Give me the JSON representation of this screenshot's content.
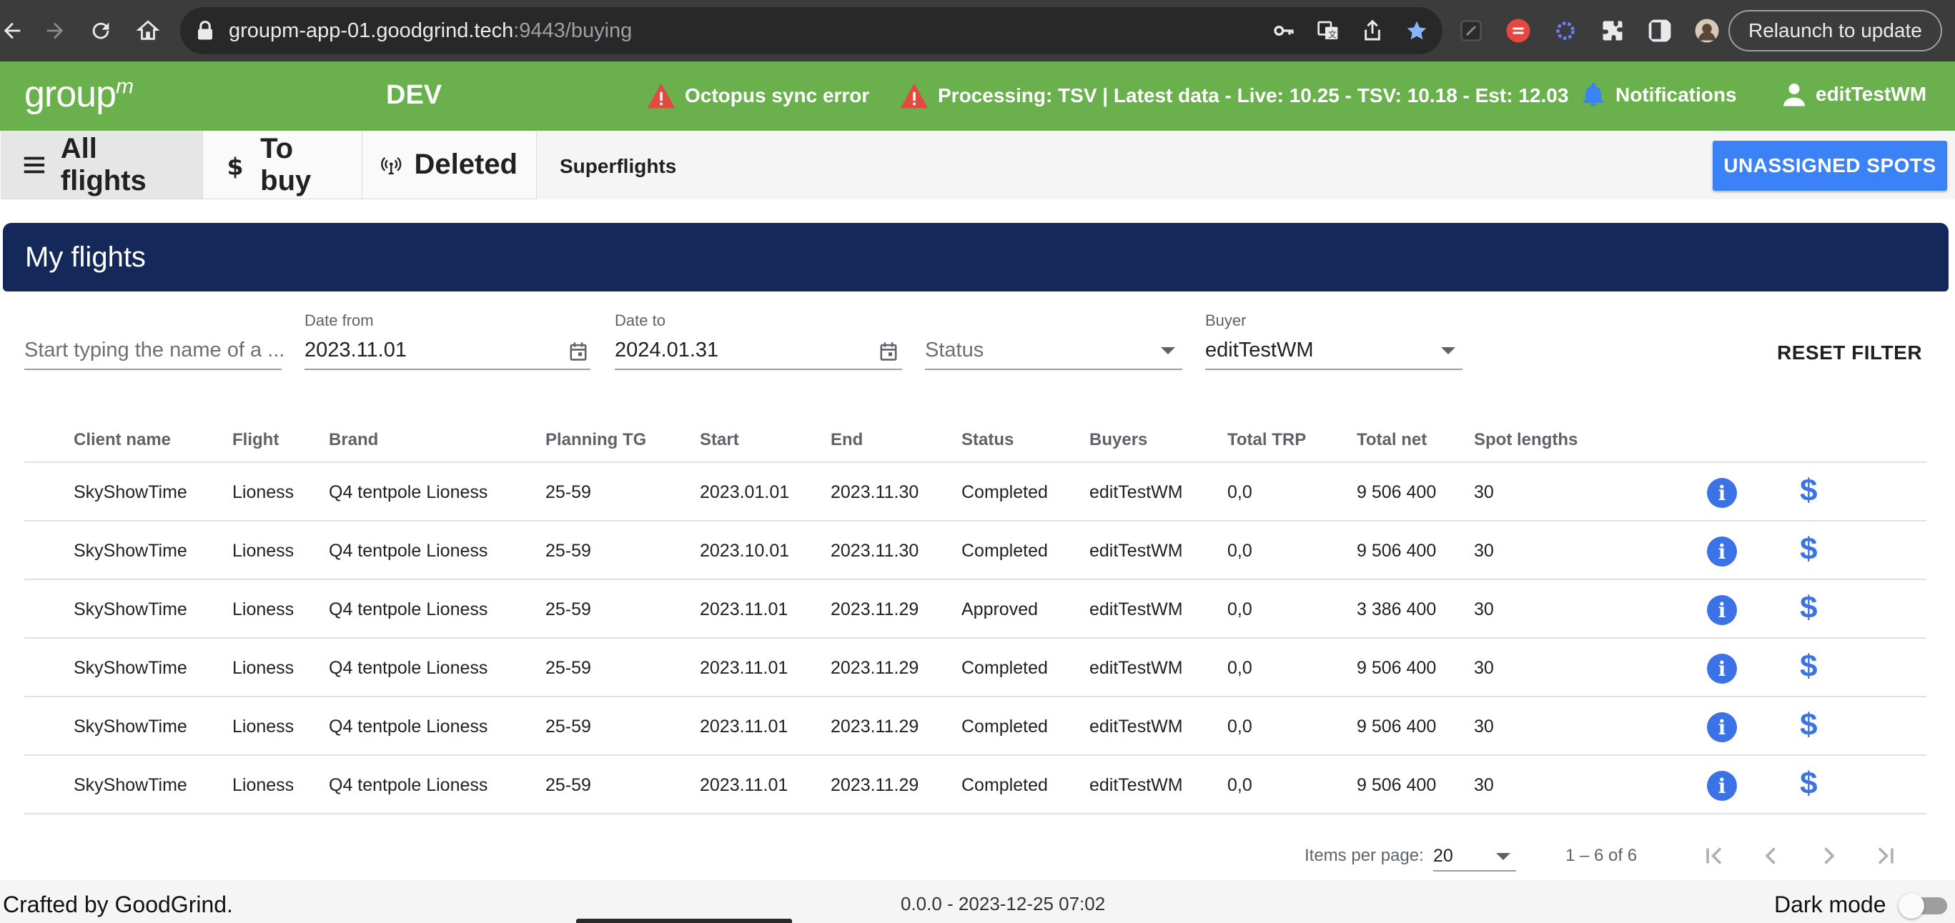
{
  "browser": {
    "url_host": "groupm-app-01.goodgrind.tech",
    "url_rest": ":9443/buying",
    "relaunch_label": "Relaunch to update"
  },
  "header": {
    "logo": "group",
    "logo_sup": "m",
    "env": "DEV",
    "sync_error": "Octopus sync error",
    "processing": "Processing: TSV | Latest data - Live: 10.25 - TSV: 10.18 - Est: 12.03",
    "notifications": "Notifications",
    "user": "editTestWM"
  },
  "tabs": {
    "all_flights": "All flights",
    "to_buy": "To buy",
    "deleted": "Deleted",
    "superflights": "Superflights",
    "unassigned": "UNASSIGNED SPOTS"
  },
  "panel": {
    "title": "My flights"
  },
  "filters": {
    "search_placeholder": "Start typing the name of a ...",
    "date_from_label": "Date from",
    "date_from": "2023.11.01",
    "date_to_label": "Date to",
    "date_to": "2024.01.31",
    "status_placeholder": "Status",
    "buyer_label": "Buyer",
    "buyer": "editTestWM",
    "reset": "RESET FILTER"
  },
  "table": {
    "columns": [
      "Client name",
      "Flight",
      "Brand",
      "Planning TG",
      "Start",
      "End",
      "Status",
      "Buyers",
      "Total TRP",
      "Total net",
      "Spot lengths"
    ],
    "rows": [
      [
        "SkyShowTime",
        "Lioness",
        "Q4 tentpole Lioness",
        "25-59",
        "2023.01.01",
        "2023.11.30",
        "Completed",
        "editTestWM",
        "0,0",
        "9 506 400",
        "30"
      ],
      [
        "SkyShowTime",
        "Lioness",
        "Q4 tentpole Lioness",
        "25-59",
        "2023.10.01",
        "2023.11.30",
        "Completed",
        "editTestWM",
        "0,0",
        "9 506 400",
        "30"
      ],
      [
        "SkyShowTime",
        "Lioness",
        "Q4 tentpole Lioness",
        "25-59",
        "2023.11.01",
        "2023.11.29",
        "Approved",
        "editTestWM",
        "0,0",
        "3 386 400",
        "30"
      ],
      [
        "SkyShowTime",
        "Lioness",
        "Q4 tentpole Lioness",
        "25-59",
        "2023.11.01",
        "2023.11.29",
        "Completed",
        "editTestWM",
        "0,0",
        "9 506 400",
        "30"
      ],
      [
        "SkyShowTime",
        "Lioness",
        "Q4 tentpole Lioness",
        "25-59",
        "2023.11.01",
        "2023.11.29",
        "Completed",
        "editTestWM",
        "0,0",
        "9 506 400",
        "30"
      ],
      [
        "SkyShowTime",
        "Lioness",
        "Q4 tentpole Lioness",
        "25-59",
        "2023.11.01",
        "2023.11.29",
        "Completed",
        "editTestWM",
        "0,0",
        "9 506 400",
        "30"
      ]
    ],
    "info_glyph": "i",
    "dollar_glyph": "$"
  },
  "paginator": {
    "label": "Items per page:",
    "per_page": "20",
    "range": "1 – 6 of 6"
  },
  "footer": {
    "crafted": "Crafted by GoodGrind.",
    "version": "0.0.0 - 2023-12-25 07:02",
    "dark_mode": "Dark mode"
  },
  "colors": {
    "header_green": "#6ab04c",
    "panel_navy": "#14295a",
    "accent_blue": "#3b82f6",
    "warning_red": "#e5483f"
  }
}
